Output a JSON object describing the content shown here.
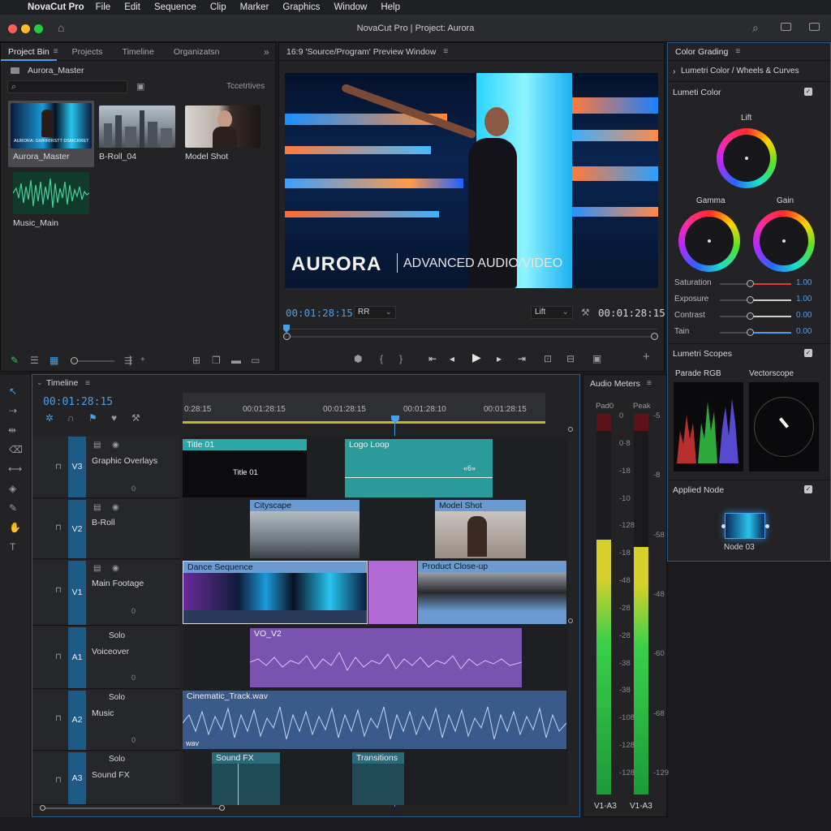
{
  "menubar": {
    "app": "NovaCut Pro",
    "items": [
      "File",
      "Edit",
      "Sequence",
      "Clip",
      "Marker",
      "Graphics",
      "Window",
      "Help"
    ]
  },
  "window_title": "NovaCut Pro | Project: Aurora",
  "project_panel": {
    "tabs": [
      "Project Bin",
      "Projects",
      "Timeline",
      "Organizatsn"
    ],
    "folder": "Aurora_Master",
    "filter_label": "Tccetrtives",
    "items": [
      {
        "label": "Aurora_Master",
        "overlay": "AURORA: GWRRIRSTT DSMCRRET"
      },
      {
        "label": "B-Roll_04"
      },
      {
        "label": "Model Shot"
      },
      {
        "label": "Music_Main"
      }
    ]
  },
  "program": {
    "header": "16:9 'Source/Program' Preview Window",
    "title_big": "AURORA",
    "title_sub": "ADVANCED AUDIO/VIDEO",
    "tc_left": "00:01:28:15",
    "tc_right": "00:01:28:15",
    "zoom": "RR",
    "fit": "Lift"
  },
  "color": {
    "header": "Color Grading",
    "section": "Lumetri Color / Wheels & Curves",
    "lumetri": "Lumeti Color",
    "lift": "Lift",
    "gamma": "Gamma",
    "gain": "Gain",
    "sliders": [
      {
        "name": "Saturation",
        "value": "1.00",
        "color": "#e23838",
        "pos": 0.42
      },
      {
        "name": "Exposure",
        "value": "1.00",
        "color": "#cfcfcf",
        "pos": 0.42
      },
      {
        "name": "Contrast",
        "value": "0.00",
        "color": "#cfcfcf",
        "pos": 0.42
      },
      {
        "name": "Tain",
        "value": "0.00",
        "color": "#4a9fe8",
        "pos": 0.42
      }
    ],
    "scopes": "Lumetri Scopes",
    "parade": "Parade RGB",
    "vectorscope": "Vectorscope",
    "applied": "Applied Node",
    "node": "Node 03"
  },
  "timeline": {
    "title": "Timeline",
    "tc": "00:01:28:15",
    "ruler": [
      "0:28:15",
      "00:01:28:15",
      "00:01:28:15",
      "00:01:28:10",
      "00:01:28:15"
    ],
    "zero": "0",
    "tracks": [
      {
        "id": "V3",
        "name": "Graphic Overlays"
      },
      {
        "id": "V2",
        "name": "B-Roll"
      },
      {
        "id": "V1",
        "name": "Main Footage"
      },
      {
        "id": "A1",
        "name": "Voiceover",
        "solo": "Solo"
      },
      {
        "id": "A2",
        "name": "Music",
        "solo": "Solo"
      },
      {
        "id": "A3",
        "name": "Sound FX",
        "solo": "Solo"
      }
    ],
    "clips": {
      "title01": "Title 01",
      "title01_inner": "Title 01",
      "logo": "Logo Loop",
      "logo_kf": "«6»",
      "city": "Cityscape",
      "model": "Model Shot",
      "dance": "Dance Sequence",
      "product": "Product Close-up",
      "vo": "VO_V2",
      "music": "Cinematic_Track.wav",
      "music_sub": "wav",
      "sfx": "Sound FX",
      "transitions": "Transitions"
    }
  },
  "meters": {
    "title": "Audio Meters",
    "left_head": "Pad0",
    "right_head": "Peak",
    "left_scale": [
      "0",
      "0·8",
      "-18",
      "-10",
      "-128",
      "-18",
      "-48",
      "-28",
      "-28",
      "-38",
      "-38",
      "-108",
      "-128",
      "-128"
    ],
    "right_scale": [
      "-5",
      "-8",
      "-58",
      "-48",
      "-60",
      "-68",
      "-129"
    ],
    "left_foot": "V1-A3",
    "right_foot": "V1-A3",
    "level_left": 0.7,
    "level_right": 0.68
  }
}
